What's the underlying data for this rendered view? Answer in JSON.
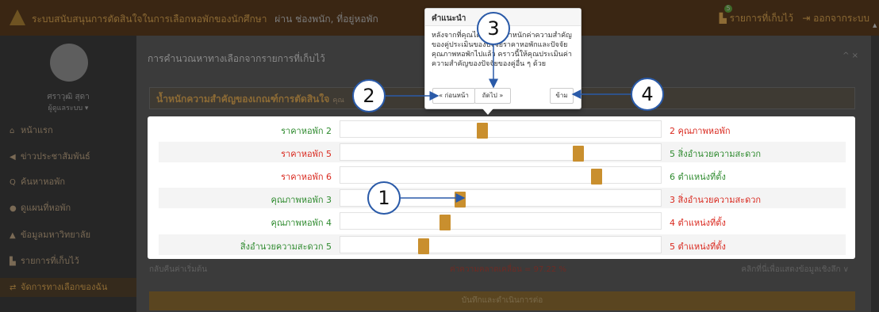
{
  "topbar": {
    "title": "ระบบสนับสนุนการตัดสินใจในการเลือกหอพักของนักศึกษา",
    "user": "ผ่าน ช่องพนัก, ที่อยู่หอพัก",
    "saved_label": "รายการที่เก็บไว้",
    "badge_count": "5",
    "logout_label": "ออกจากระบบ"
  },
  "sidebar": {
    "user_name": "ศราวุฒิ สุดา",
    "user_role": "ผู้ดูแลระบบ ▾",
    "items": [
      {
        "label": "หน้าแรก",
        "icon": "home-icon"
      },
      {
        "label": "ข่าวประชาสัมพันธ์",
        "icon": "megaphone-icon"
      },
      {
        "label": "ค้นหาหอพัก",
        "icon": "search-icon"
      },
      {
        "label": "ดูแผนที่หอพัก",
        "icon": "map-pin-icon"
      },
      {
        "label": "ข้อมูลมหาวิทยาลัย",
        "icon": "graduation-cap-icon"
      },
      {
        "label": "รายการที่เก็บไว้",
        "icon": "bookmark-icon"
      },
      {
        "label": "จัดการทางเลือกของฉัน",
        "icon": "exchange-icon"
      }
    ]
  },
  "main": {
    "panel_title": "การคำนวณหาทางเลือกจากรายการที่เก็บไว้",
    "panel_controls": "^ ×",
    "section_title": "น้ำหนักความสำคัญของเกณฑ์การตัดสินใจ",
    "section_sub": "คุณ",
    "reset_label": "กลับคืนค่าเริ่มต้น",
    "consistency_label": "ค่าความคลาดเคลื่อน = 97.22 %",
    "click_more_label": "คลิกที่นี่เพื่อแสดงข้อมูลเชิงลึก ∨",
    "confirm_label": "บันทึกและดำเนินการต่อ"
  },
  "comparisons": [
    {
      "left": "ราคาหอพัก 2",
      "left_color": "green",
      "right": "2 คุณภาพหอพัก",
      "right_color": "red",
      "value": 0.44
    },
    {
      "left": "ราคาหอพัก 5",
      "left_color": "red",
      "right": "5 สิ่งอำนวยความสะดวก",
      "right_color": "green",
      "value": 0.75
    },
    {
      "left": "ราคาหอพัก 6",
      "left_color": "red",
      "right": "6 ตำแหน่งที่ตั้ง",
      "right_color": "green",
      "value": 0.81
    },
    {
      "left": "คุณภาพหอพัก 3",
      "left_color": "green",
      "right": "3 สิ่งอำนวยความสะดวก",
      "right_color": "red",
      "value": 0.37
    },
    {
      "left": "คุณภาพหอพัก 4",
      "left_color": "green",
      "right": "4 ตำแหน่งที่ตั้ง",
      "right_color": "red",
      "value": 0.32
    },
    {
      "left": "สิ่งอำนวยความสะดวก 5",
      "left_color": "green",
      "right": "5 ตำแหน่งที่ตั้ง",
      "right_color": "red",
      "value": 0.25
    }
  ],
  "tooltip": {
    "title": "คำแนะนำ",
    "body": "หลังจากที่คุณได้กำหนดน้ำหนักค่าความสำคัญของคู่ประเมินของปัจจัยราคาหอพักและปัจจัยคุณภาพหอพักไปแล้ว คราวนี้ให้คุณประเมินค่าความสำคัญของปัจจัยของคู่อื่น ๆ ด้วย",
    "prev_label": "« ก่อนหน้า",
    "next_label": "ถัดไป »",
    "skip_label": "ข้าม"
  },
  "callouts": [
    "1",
    "2",
    "3",
    "4"
  ],
  "colors": {
    "accent": "#c98f2e",
    "callout_border": "#2a5aa8",
    "green_text": "#2e8a2e",
    "red_text": "#d9281e"
  }
}
